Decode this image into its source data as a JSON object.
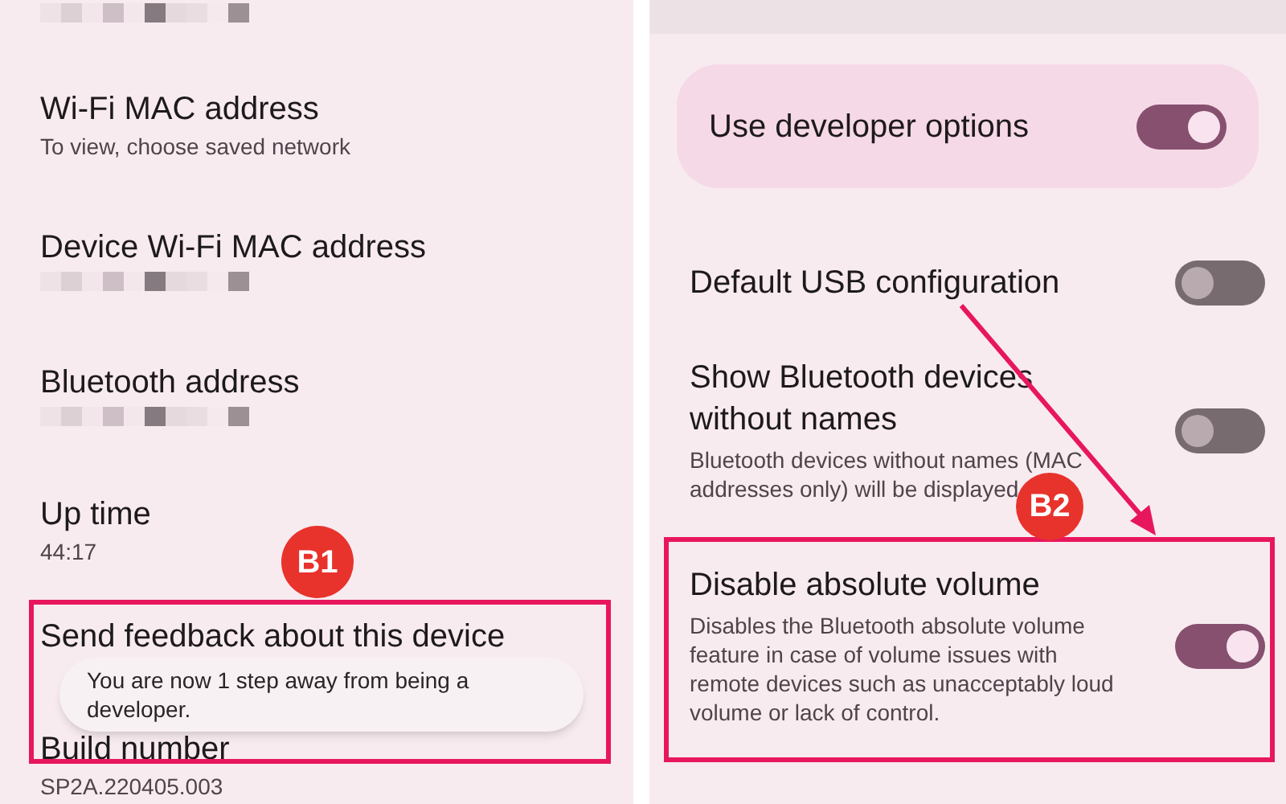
{
  "left_screen": {
    "items": [
      {
        "kind": "redacted"
      },
      {
        "title": "Wi-Fi MAC address",
        "summary": "To view, choose saved network",
        "kind": "text"
      },
      {
        "title": "Device Wi-Fi MAC address",
        "kind": "redacted"
      },
      {
        "title": "Bluetooth address",
        "kind": "redacted"
      },
      {
        "title": "Up time",
        "summary": "44:17",
        "kind": "text"
      },
      {
        "title": "Send feedback about this device",
        "kind": "text"
      },
      {
        "title": "Build number",
        "summary": "SP2A.220405.003",
        "kind": "text"
      }
    ],
    "toast": "You are now 1 step away from being a developer.",
    "badge": "B1"
  },
  "right_screen": {
    "main_switch": {
      "label": "Use developer options",
      "on": true
    },
    "settings": [
      {
        "title": "Default USB configuration",
        "on": false
      },
      {
        "title": "Show Bluetooth devices without names",
        "summary": "Bluetooth devices without names (MAC addresses only) will be displayed",
        "on": false
      },
      {
        "title": "Disable absolute volume",
        "summary": "Disables the Bluetooth absolute volume feature in case of volume issues with remote devices such as unacceptably loud volume or lack of control.",
        "on": true,
        "highlighted": true
      }
    ],
    "badge": "B2"
  }
}
